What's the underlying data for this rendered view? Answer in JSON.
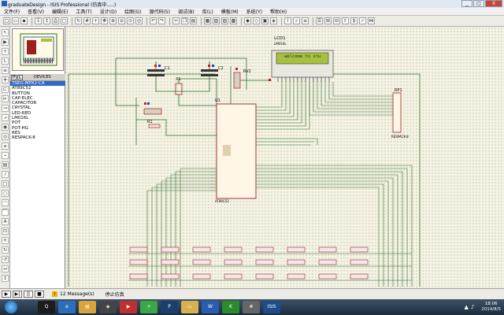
{
  "window": {
    "title": "graduateDesign - ISIS Professional (仿真中.....)",
    "buttons": [
      "_",
      "□",
      "X"
    ]
  },
  "menu": [
    "文件(F)",
    "查看(V)",
    "编辑(E)",
    "工具(T)",
    "设计(D)",
    "绘图(G)",
    "源代码(S)",
    "调试(B)",
    "库(L)",
    "模板(M)",
    "系统(Y)",
    "帮助(H)"
  ],
  "toolbar": {
    "icons": [
      "new-icon",
      "open-icon",
      "save-icon",
      "import-icon",
      "export-icon",
      "print-icon",
      "area-icon",
      "refresh-icon",
      "grid-icon",
      "origin-icon",
      "pan-icon",
      "zoom-in-icon",
      "zoom-out-icon",
      "zoom-all-icon",
      "zoom-area-icon",
      "undo-icon",
      "redo-icon",
      "cut-icon",
      "copy-icon",
      "paste-icon",
      "block-copy-icon",
      "block-move-icon",
      "block-rotate-icon",
      "block-delete-icon",
      "pick-icon",
      "make-device-icon",
      "packaging-icon",
      "decompose-icon",
      "wire-autorouter-icon",
      "search-icon",
      "property-icon",
      "design-explorer-icon",
      "new-sheet-icon",
      "remove-sheet-icon",
      "exit-parent-icon",
      "bom-icon",
      "erc-icon",
      "netlist-icon"
    ]
  },
  "devices": {
    "header": "DEVICES",
    "buttons": [
      "P",
      "L"
    ],
    "items": [
      "7SEG-MPX2-CA",
      "AT89C52",
      "BUTTON",
      "CAP-ELEC",
      "CAPACITOR",
      "CRYSTAL",
      "LED-RED",
      "LM016L",
      "POT",
      "POT-HG",
      "RES",
      "RESPACK-8"
    ],
    "selected": 0
  },
  "schematic": {
    "lcd_label": "LCD1",
    "lcd_part": "LM016L",
    "lcd_text": "welcome to stu",
    "mcu_label": "U1",
    "mcu_part": "AT89C52",
    "rp_label": "RP1",
    "rp_part": "RESPACK-8",
    "rv_label": "RV2",
    "c1": "C1",
    "c2": "C2",
    "x1": "X1",
    "r1": "R1"
  },
  "status": {
    "message_count": "12 Message(s)",
    "state": "停止仿真",
    "sim_buttons": [
      "▶",
      "▶|",
      "||",
      "■"
    ]
  },
  "clock": {
    "time": "18:06",
    "date": "2014/8/5"
  },
  "taskbar": {
    "apps": [
      {
        "name": "QQ",
        "color": "#1c1c1c"
      },
      {
        "name": "browser",
        "color": "#2c6fb8"
      },
      {
        "name": "explorer",
        "color": "#d9a43c"
      },
      {
        "name": "game",
        "color": "#444"
      },
      {
        "name": "player",
        "color": "#c03030"
      },
      {
        "name": "360",
        "color": "#39a845"
      },
      {
        "name": "ps",
        "color": "#1b3e6e"
      },
      {
        "name": "folder",
        "color": "#d8b050"
      },
      {
        "name": "word",
        "color": "#2a5db0"
      },
      {
        "name": "keil",
        "color": "#2c8c2c"
      },
      {
        "name": "calc",
        "color": "#666"
      },
      {
        "name": "ISIS",
        "color": "#1f4c8c"
      }
    ]
  },
  "colors": {
    "canvas": "#f5f3e4",
    "wire": "#2a6a2a",
    "component": "#a52020",
    "lcd": "#a8c040"
  }
}
